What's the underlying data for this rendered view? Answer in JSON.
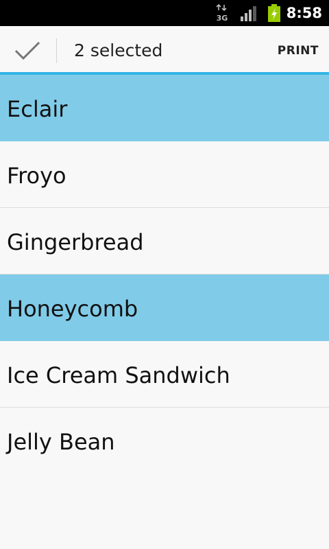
{
  "status_bar": {
    "network_type": "3G",
    "time": "8:58"
  },
  "action_bar": {
    "title": "2 selected",
    "print_label": "PRINT",
    "accent_color": "#33b5e5"
  },
  "list": {
    "items": [
      {
        "label": "Eclair",
        "selected": true
      },
      {
        "label": "Froyo",
        "selected": false
      },
      {
        "label": "Gingerbread",
        "selected": false
      },
      {
        "label": "Honeycomb",
        "selected": true
      },
      {
        "label": "Ice Cream Sandwich",
        "selected": false
      },
      {
        "label": "Jelly Bean",
        "selected": false
      }
    ],
    "selected_color": "#80cbe8"
  }
}
